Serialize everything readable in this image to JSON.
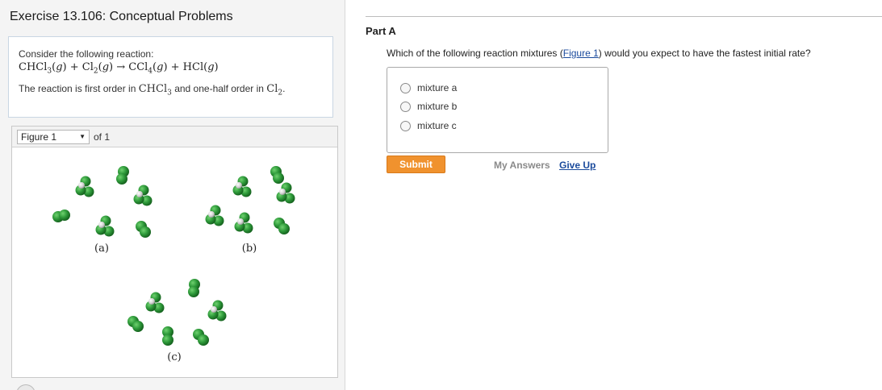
{
  "exercise": {
    "title": "Exercise 13.106: Conceptual Problems"
  },
  "intro": {
    "lead": "Consider the following reaction:",
    "note_prefix": "The reaction is first order in",
    "note_middle": "and one-half order in",
    "note_suffix": "."
  },
  "figure": {
    "selected": "Figure 1",
    "of_label": "of 1",
    "panel_labels": {
      "a": "(a)",
      "b": "(b)",
      "c": "(c)"
    }
  },
  "part": {
    "title": "Part A",
    "question_prefix": "Which of the following reaction mixtures (",
    "figure_link": "Figure 1",
    "question_suffix": ") would you expect to have the fastest initial rate?",
    "choices": [
      "mixture a",
      "mixture b",
      "mixture c"
    ],
    "submit_label": "Submit",
    "my_answers_label": "My Answers",
    "give_up_label": "Give Up"
  },
  "colors": {
    "accent_submit": "#f0922e",
    "link": "#1a4a9c",
    "molecule_green": "#2e9a3a",
    "molecule_white": "#e6e6e6"
  }
}
